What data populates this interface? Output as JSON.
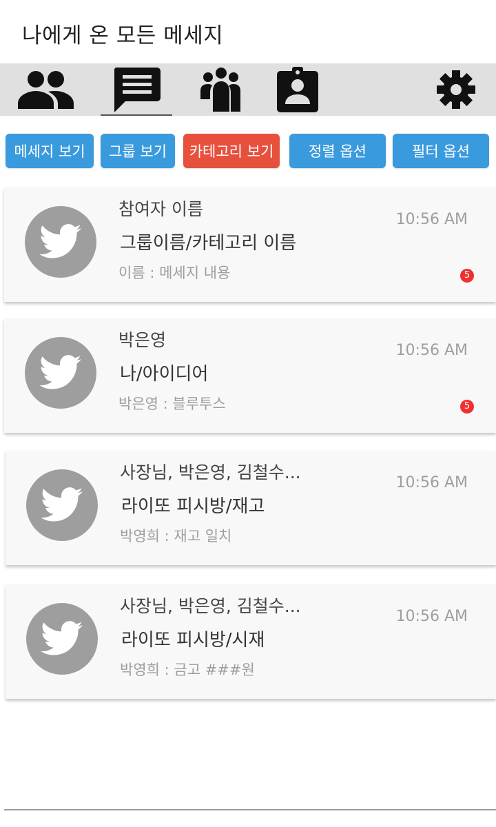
{
  "header": {
    "title": "나에게 온 모든 메세지"
  },
  "tabs": [
    {
      "name": "tab-friends",
      "icon": "people-icon"
    },
    {
      "name": "tab-messages",
      "icon": "chat-message-icon",
      "selected": true
    },
    {
      "name": "tab-groups",
      "icon": "group-icon"
    },
    {
      "name": "tab-contacts",
      "icon": "contact-card-icon"
    },
    {
      "name": "tab-settings",
      "icon": "gear-icon"
    }
  ],
  "toolbar": {
    "view_messages": "메세지 보기",
    "view_groups": "그룹 보기",
    "view_categories": "카테고리 보기",
    "sort_options": "정렬 옵션",
    "filter_options": "필터 옵션"
  },
  "colors": {
    "button_blue": "#3a9ade",
    "button_active_red": "#e8503e",
    "tabbar_bg": "#e0e0e0",
    "avatar_gray": "#9e9e9e",
    "badge_red": "#f03030"
  },
  "conversations": [
    {
      "participants": "참여자 이름",
      "group": "그룹이름/카테고리 이름",
      "last_message": "이름 : 메세지 내용",
      "time": "10:56 AM",
      "unread": "5"
    },
    {
      "participants": "박은영",
      "group": "나/아이디어",
      "last_message": "박은영 : 블루투스",
      "time": "10:56 AM",
      "unread": "5"
    },
    {
      "participants": "사장님, 박은영, 김철수...",
      "group": "라이또 피시방/재고",
      "last_message": "박영희 : 재고 일치",
      "time": "10:56 AM"
    },
    {
      "participants": "사장님, 박은영, 김철수...",
      "group": "라이또 피시방/시재",
      "last_message": "박영희 : 금고 ###원",
      "time": "10:56 AM"
    }
  ]
}
